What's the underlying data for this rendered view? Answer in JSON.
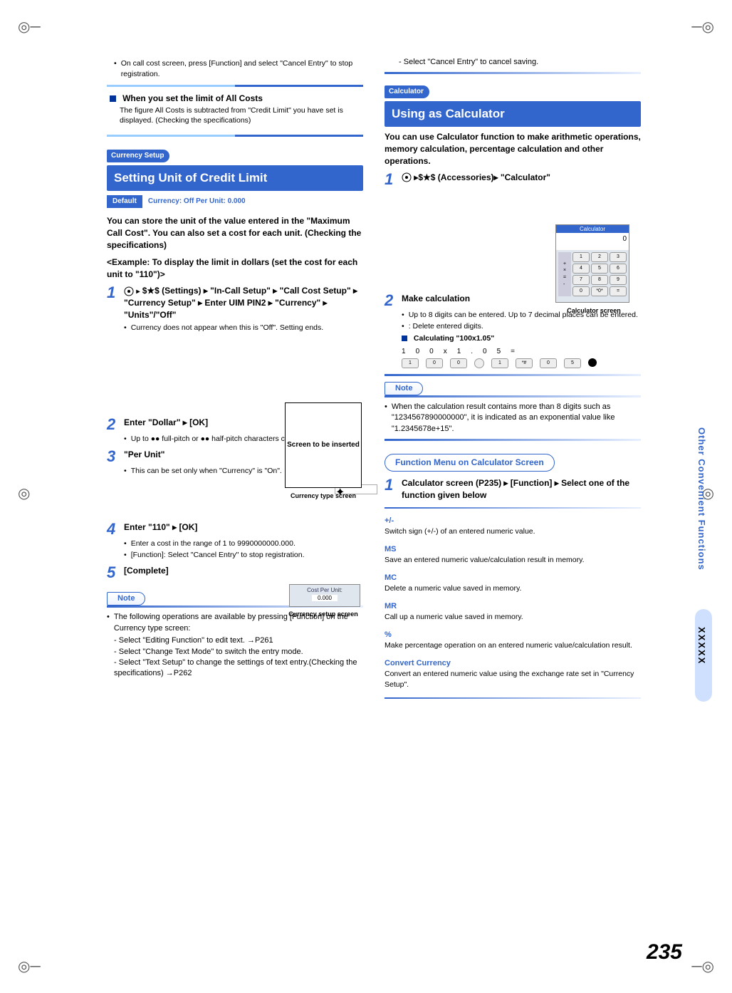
{
  "page_number": "235",
  "side": {
    "category": "Other Convenient Functions",
    "mark": "XXXXX"
  },
  "left": {
    "top_bullet": "On call cost screen, press       [Function] and select \"Cancel Entry\" to stop registration.",
    "info_heading": "When you set the limit of All Costs",
    "info_text": "The figure All Costs is subtracted from \"Credit Limit\" you have set is displayed. (Checking the specifications)",
    "tag": "Currency Setup",
    "h2": "Setting Unit of Credit Limit",
    "default_label": "Default",
    "default_value": "Currency: Off    Per Unit: 0.000",
    "intro": "You can store the unit of the value entered in the \"Maximum Call Cost\". You can also set a cost for each unit. (Checking the specifications)",
    "example": "<Example: To display the limit in dollars (set the cost for each unit to \"110\")>",
    "step1": "$★$ (Settings) ▸ \"In-Call Setup\" ▸ \"Call Cost Setup\" ▸ \"Currency Setup\" ▸ Enter UIM PIN2 ▸ \"Currency\" ▸ \"Units\"/\"Off\"",
    "step1_note": "Currency does not appear when this is \"Off\". Setting ends.",
    "screen1_text": "Screen to be inserted",
    "screen1_caption": "Currency type screen",
    "step2": "Enter \"Dollar\" ▸        [OK]",
    "step2_note": "Up to ●● full-pitch or ●● half-pitch characters can be entered.",
    "step3": "\"Per Unit\"",
    "step3_note": "This can be set only when \"Currency\" is \"On\".",
    "screen2_caption": "Currency setup screen",
    "step4": "Enter \"110\" ▸        [OK]",
    "step4_notes": [
      "Enter a cost in the range of 1 to 9990000000.000.",
      "      [Function]: Select \"Cancel Entry\" to stop registration."
    ],
    "step5": "       [Complete]",
    "note_label": "Note",
    "note_lead": "The following operations are available by pressing        [Function] on the Currency type screen:",
    "note_items": [
      "Select \"Editing Function\" to edit text. →P261",
      "Select \"Change Text Mode\" to switch the entry mode.",
      "Select \"Text Setup\" to change the settings of text entry.(Checking the specifications) →P262"
    ]
  },
  "right": {
    "top_dash": "Select \"Cancel Entry\" to cancel saving.",
    "tag": "Calculator",
    "h2": "Using as Calculator",
    "intro": "You can use Calculator function to make arithmetic operations, memory calculation, percentage calculation and other operations.",
    "step1": "▸$★$ (Accessories)▸ \"Calculator\"",
    "screen_caption": "Calculator screen",
    "step2_head": "Make calculation",
    "step2_notes": [
      "Up to 8 digits can be entered. Up to 7 decimal places can be entered.",
      "       : Delete entered digits."
    ],
    "calc_heading": "Calculating \"100x1.05\"",
    "keys": [
      "1",
      "0",
      "0",
      "x",
      "1",
      ".",
      "0",
      "5",
      "="
    ],
    "note_label": "Note",
    "note_text": "When the calculation result contains more than 8 digits such as \"1234567890000000\", it is indicated as an exponential value like \"1.2345678e+15\".",
    "func_heading": "Function Menu on Calculator Screen",
    "func_step": "Calculator screen (P235) ▸       [Function] ▸ Select one of the function given below",
    "func_items": [
      {
        "t": "+/-",
        "d": "Switch sign (+/-) of an entered numeric value."
      },
      {
        "t": "MS",
        "d": "Save an entered numeric value/calculation result in memory."
      },
      {
        "t": "MC",
        "d": "Delete a numeric value saved in memory."
      },
      {
        "t": "MR",
        "d": "Call up a numeric value saved in memory."
      },
      {
        "t": "%",
        "d": "Make percentage operation on an entered numeric value/calculation result."
      },
      {
        "t": "Convert Currency",
        "d": "Convert an entered numeric value using the exchange rate set in \"Currency Setup\"."
      }
    ]
  }
}
